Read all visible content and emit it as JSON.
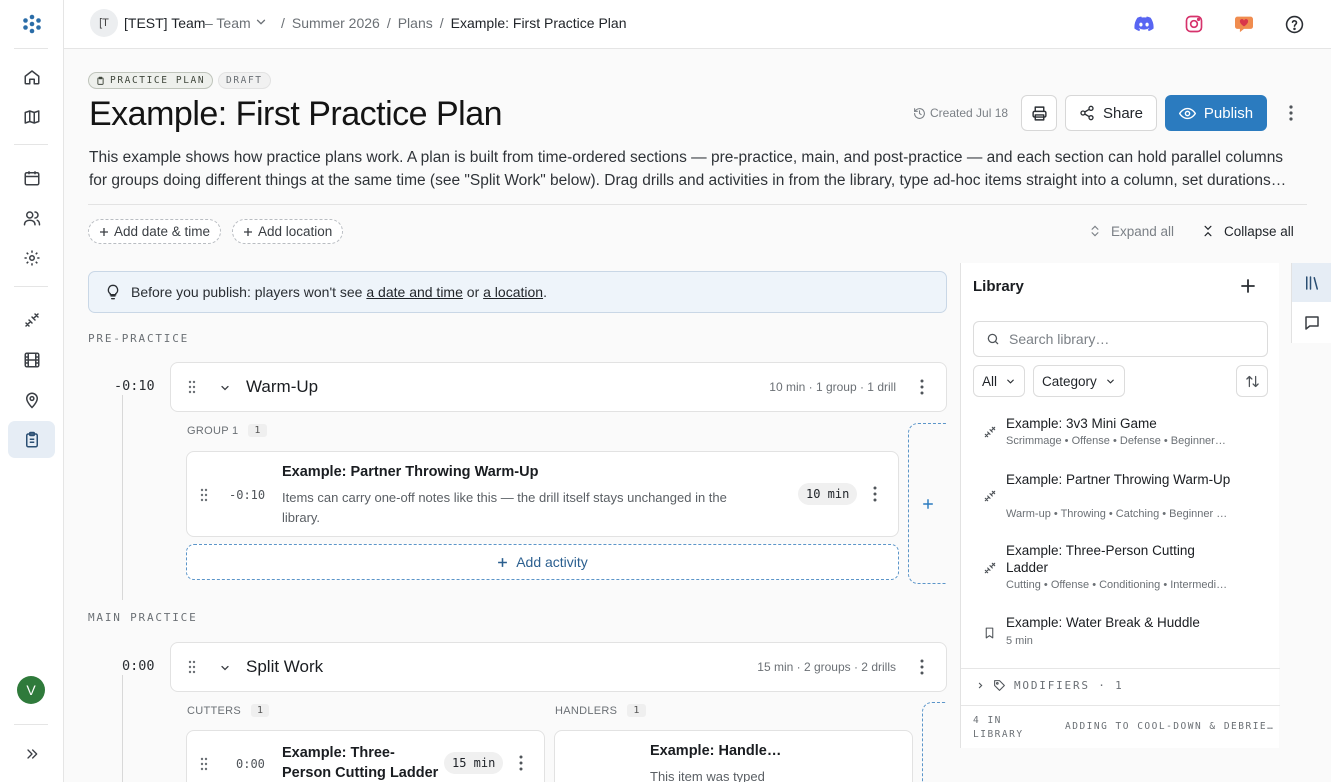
{
  "nav": {
    "avatar_initial": "V",
    "items": [
      "home-icon",
      "map-icon",
      "calendar-icon",
      "users-icon",
      "settings-icon",
      "drills-icon",
      "film-icon",
      "location-icon",
      "clipboard-icon"
    ],
    "expand_icon": "double-chevron-right-icon"
  },
  "topbar": {
    "team_badge": "[T",
    "team_name": "[TEST] Team",
    "team_kind": "– Team",
    "breadcrumbs": [
      "Summer 2026",
      "Plans",
      "Example: First Practice Plan"
    ],
    "separator": "/"
  },
  "header": {
    "tag_plan": "PRACTICE PLAN",
    "tag_draft": "DRAFT",
    "title": "Example: First Practice Plan",
    "created": "Created Jul 18",
    "share_label": "Share",
    "publish_label": "Publish",
    "description": "This example shows how practice plans work. A plan is built from time-ordered sections — pre-practice, main, and post-practice — and each section can hold parallel columns for groups doing different things at the same time (see \"Split Work\" below). Drag drills and activities in from the library, type ad-hoc items straight into a column, set durations…",
    "add_date": "Add date & time",
    "add_location": "Add location",
    "expand_all": "Expand all",
    "collapse_all": "Collapse all"
  },
  "callout": {
    "prefix": "Before you publish: players won't see ",
    "link1": "a date and time",
    "mid": " or ",
    "link2": "a location",
    "suffix": "."
  },
  "sections": {
    "pre": {
      "label": "PRE-PRACTICE",
      "time": "-0:10",
      "name": "Warm-Up",
      "meta": "10 min · 1 group · 1 drill",
      "group_label": "GROUP 1",
      "group_count": "1",
      "drill": {
        "time": "-0:10",
        "name": "Example: Partner Throwing Warm-Up",
        "note": "Items can carry one-off notes like this — the drill itself stays unchanged in the library.",
        "duration": "10 min"
      },
      "add_activity": "Add activity"
    },
    "main": {
      "label": "MAIN PRACTICE",
      "time": "0:00",
      "name": "Split Work",
      "meta": "15 min · 2 groups · 2 drills",
      "group1_label": "CUTTERS",
      "group1_count": "1",
      "group2_label": "HANDLERS",
      "group2_count": "1",
      "drill1": {
        "time": "0:00",
        "name": "Example: Three-Person Cutting Ladder",
        "duration": "15 min"
      },
      "drill2": {
        "name": "Example: Handle…",
        "note": "This item was typed"
      }
    }
  },
  "library": {
    "title": "Library",
    "search_placeholder": "Search library…",
    "filter_all": "All",
    "filter_category": "Category",
    "items": [
      {
        "name": "Example: 3v3 Mini Game",
        "meta": "Scrimmage • Offense • Defense • Beginner …",
        "icon": "drill-icon"
      },
      {
        "name": "Example: Partner Throwing Warm-Up",
        "meta": "Warm-up • Throwing • Catching • Beginner …",
        "icon": "drill-icon"
      },
      {
        "name": "Example: Three-Person Cutting Ladder",
        "meta": "Cutting • Offense • Conditioning • Intermedi…",
        "icon": "drill-icon"
      },
      {
        "name": "Example: Water Break & Huddle",
        "meta": "5 min",
        "icon": "bookmark-icon"
      }
    ],
    "modifiers": "MODIFIERS · 1",
    "count_label": "4 IN LIBRARY",
    "footer_status": "ADDING TO COOL-DOWN & DEBRIEF"
  },
  "colors": {
    "accent": "#2b7bbf",
    "active_nav": "#e6edf5",
    "avatar": "#2f7a3b"
  }
}
